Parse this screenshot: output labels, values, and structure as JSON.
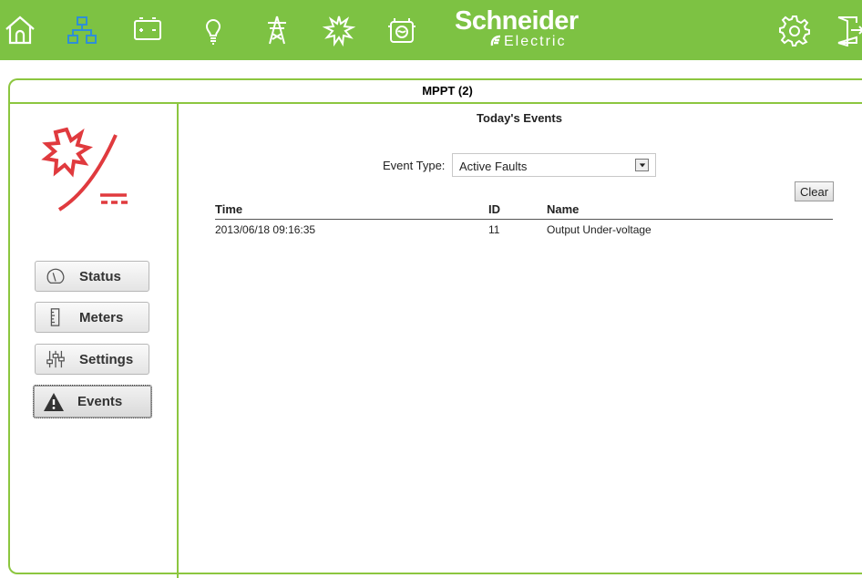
{
  "nav": {
    "icons": [
      "home-icon",
      "network-icon",
      "battery-icon",
      "lightbulb-icon",
      "transmission-tower-icon",
      "solar-icon",
      "generator-icon"
    ],
    "right_icons": [
      "gear-icon",
      "logout-door-icon"
    ]
  },
  "logo": {
    "line1": "Schneider",
    "line2": "Electric"
  },
  "colors": {
    "brand_green": "#7dc243",
    "border_green": "#8cc63f",
    "device_red": "#e03a3e"
  },
  "panel": {
    "title": "MPPT (2)"
  },
  "sidebar": {
    "device_icon": "mppt-solar-charger-icon",
    "items": [
      {
        "label": "Status",
        "icon": "gauge-icon",
        "active": false
      },
      {
        "label": "Meters",
        "icon": "meter-icon",
        "active": false
      },
      {
        "label": "Settings",
        "icon": "sliders-icon",
        "active": false
      },
      {
        "label": "Events",
        "icon": "warning-icon",
        "active": true
      }
    ]
  },
  "events": {
    "title": "Today's Events",
    "event_type_label": "Event Type:",
    "event_type_value": "Active Faults",
    "clear_label": "Clear",
    "columns": {
      "time": "Time",
      "id": "ID",
      "name": "Name"
    },
    "rows": [
      {
        "time": "2013/06/18 09:16:35",
        "id": "11",
        "name": "Output Under-voltage"
      }
    ]
  }
}
